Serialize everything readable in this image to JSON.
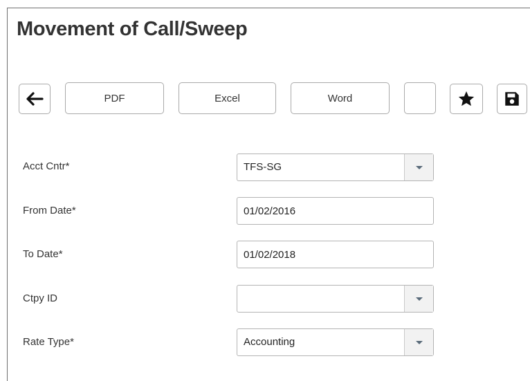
{
  "page": {
    "title": "Movement of Call/Sweep"
  },
  "toolbar": {
    "back_icon": "arrow-left-icon",
    "pdf_label": "PDF",
    "excel_label": "Excel",
    "word_label": "Word",
    "blank_label": "",
    "favorite_icon": "star-icon",
    "save_icon": "floppy-disk-icon"
  },
  "form": {
    "acct_cntr": {
      "label": "Acct Cntr*",
      "value": "TFS-SG"
    },
    "from_date": {
      "label": "From Date*",
      "value": "01/02/2016"
    },
    "to_date": {
      "label": "To Date*",
      "value": "01/02/2018"
    },
    "ctpy_id": {
      "label": "Ctpy ID",
      "value": ""
    },
    "rate_type": {
      "label": "Rate Type*",
      "value": "Accounting"
    }
  },
  "colors": {
    "border": "#a9a9a9",
    "text": "#333333",
    "dropdown_bg": "#f2f2f2",
    "arrow": "#5a6b7a"
  }
}
